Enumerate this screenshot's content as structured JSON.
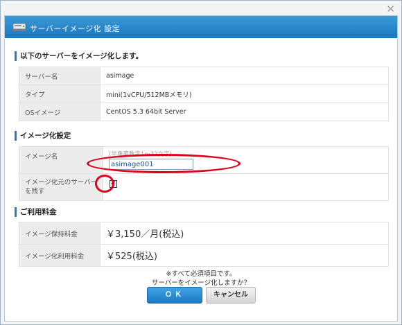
{
  "window": {
    "close_glyph": "✕"
  },
  "dialog": {
    "title": "サーバーイメージ化  設定"
  },
  "section_target": {
    "heading": "以下のサーバーをイメージ化します。",
    "rows": [
      {
        "label": "サーバー名",
        "value": "asimage"
      },
      {
        "label": "タイプ",
        "value": "mini(1vCPU/512MBメモリ)"
      },
      {
        "label": "OSイメージ",
        "value": "CentOS 5.3 64bit Server"
      }
    ]
  },
  "section_settings": {
    "heading": "イメージ化設定",
    "image_name_label": "イメージ名",
    "image_name_hint": "(半角英数字1～32文字)",
    "image_name_value": "asimage001",
    "keep_server_label": "イメージ化元のサーバーを残す",
    "keep_server_checked": true,
    "check_glyph": "✔"
  },
  "section_fees": {
    "heading": "ご利用料金",
    "rows": [
      {
        "label": "イメージ保持料金",
        "value": "￥3,150／月(税込)"
      },
      {
        "label": "イメージ化利用料金",
        "value": "￥525(税込)"
      }
    ]
  },
  "footer": {
    "note": "※すべて必須項目です。",
    "confirm": "サーバーをイメージ化しますか？",
    "ok_label": "ＯＫ",
    "cancel_label": "キャンセル"
  },
  "colors": {
    "title_bar": "#1f82c8",
    "section_accent": "#2b7ad0",
    "price": "#e0004d",
    "annotation_circle": "#e0001b"
  }
}
